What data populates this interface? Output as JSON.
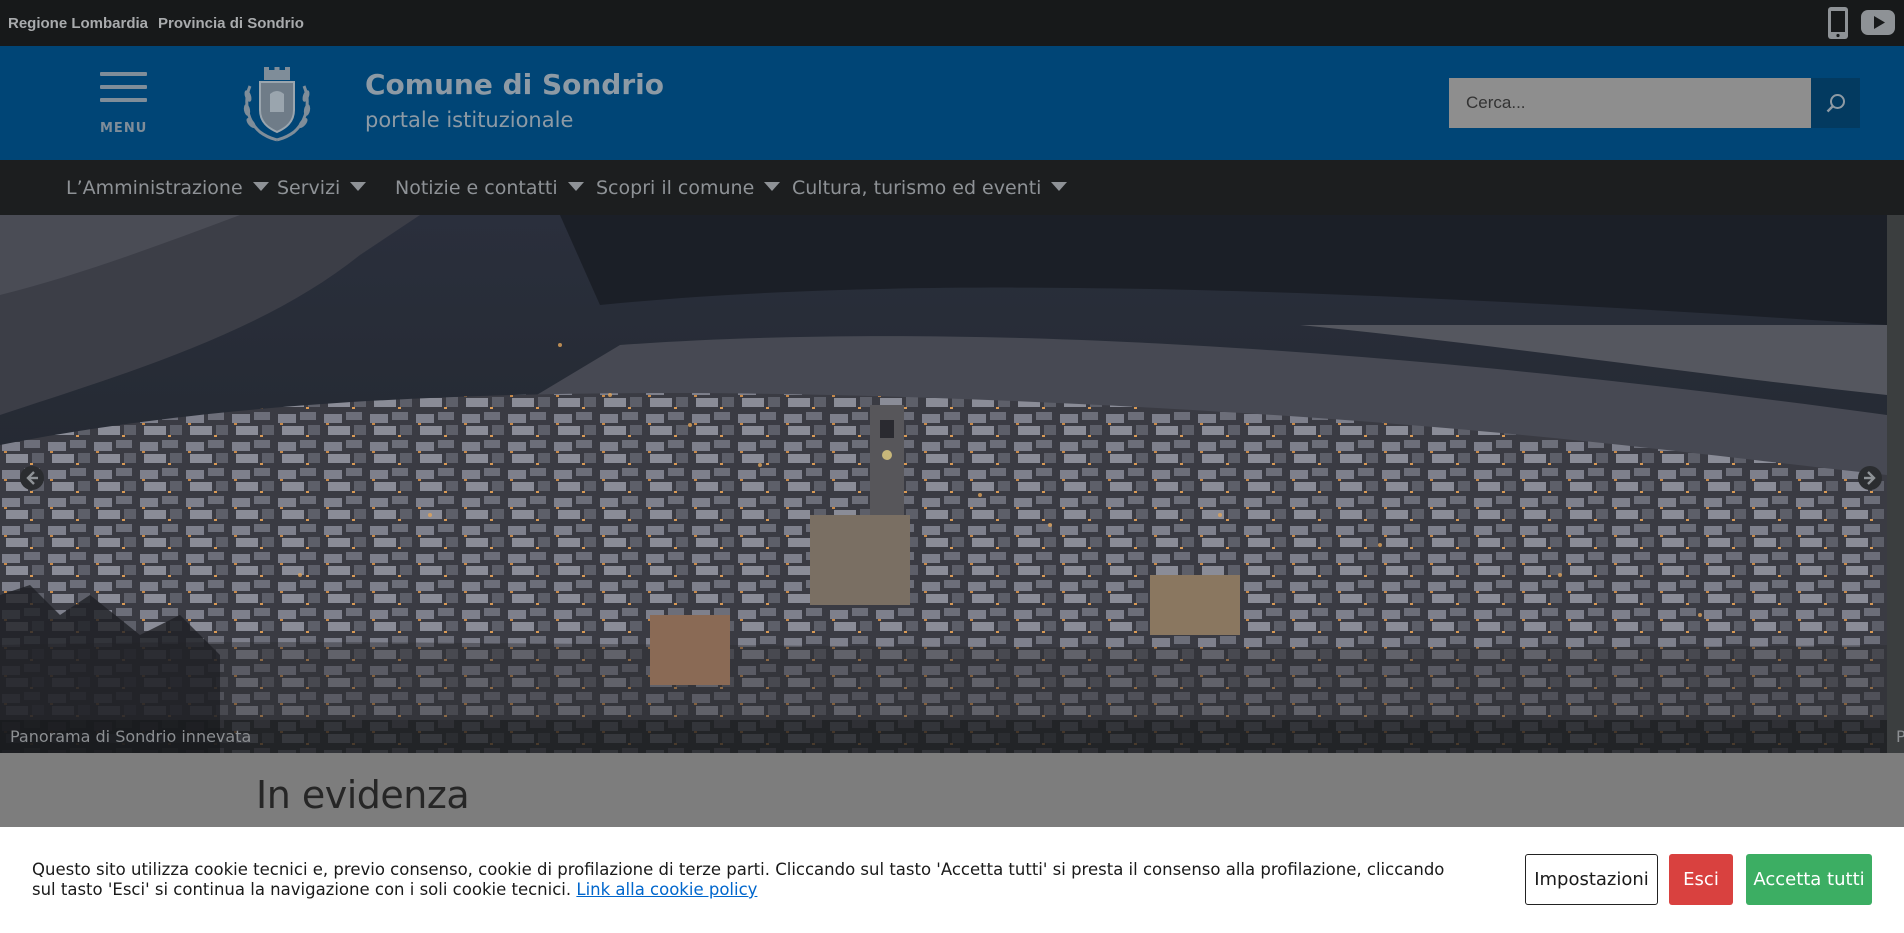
{
  "topbar": {
    "links": [
      "Regione Lombardia",
      "Provincia di Sondrio"
    ],
    "social_icons": [
      "mobile-icon",
      "youtube-icon"
    ]
  },
  "header": {
    "menu_label": "MENU",
    "title": "Comune di Sondrio",
    "subtitle": "portale istituzionale",
    "search_placeholder": "Cerca..."
  },
  "nav": {
    "items": [
      {
        "label": "L’Amministrazione"
      },
      {
        "label": "Servizi"
      },
      {
        "label": "Notizie e contatti"
      },
      {
        "label": "Scopri il comune"
      },
      {
        "label": "Cultura, turismo ed eventi"
      }
    ]
  },
  "hero": {
    "caption": "Panorama di Sondrio innevata",
    "caption_next": "P"
  },
  "section": {
    "title": "In evidenza"
  },
  "cookie": {
    "text": "Questo sito utilizza cookie tecnici e, previo consenso, cookie di profilazione di terze parti. Cliccando sul tasto 'Accetta tutti' si presta il consenso alla profilazione, cliccando sul tasto 'Esci' si continua la navigazione con i soli cookie tecnici.",
    "link": "Link alla cookie policy",
    "buttons": {
      "settings": "Impostazioni",
      "exit": "Esci",
      "accept": "Accetta tutti"
    }
  },
  "colors": {
    "header_blue": "#004576",
    "exit_red": "#d9413f",
    "accept_green": "#3cae63",
    "link_blue": "#0066cc"
  }
}
